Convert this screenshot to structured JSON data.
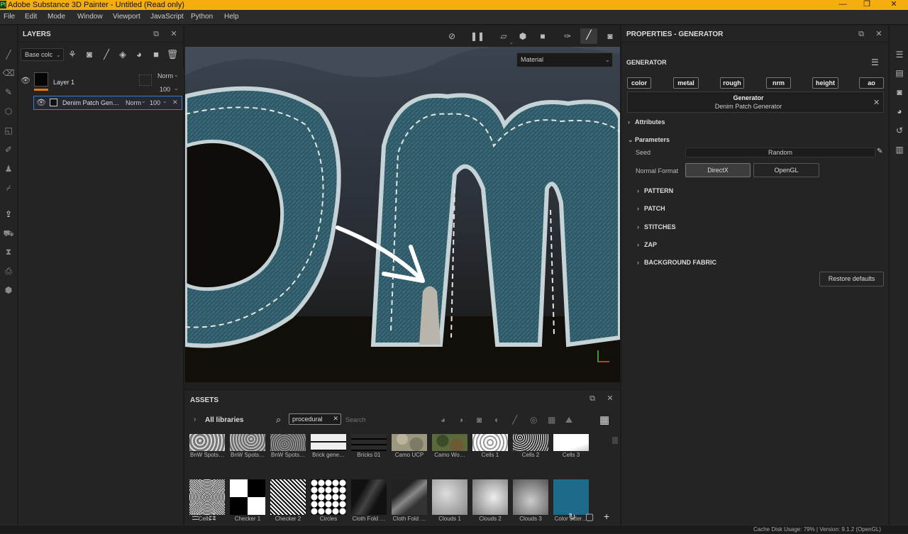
{
  "titlebar": {
    "title": "Adobe Substance 3D Painter - Untitled (Read only)",
    "minimize": "—",
    "restore": "❐",
    "close": "✕"
  },
  "menu": [
    "File",
    "Edit",
    "Mode",
    "Window",
    "Viewport",
    "JavaScript",
    "Python",
    "Help"
  ],
  "layers": {
    "title": "LAYERS",
    "channel_select": "Base colc",
    "layer1": {
      "name": "Layer 1",
      "blend": "Norm",
      "opacity": "100"
    },
    "effect": {
      "name": "Denim Patch Gen…",
      "blend": "Norm",
      "opacity": "100"
    }
  },
  "viewport": {
    "material_select": "Material"
  },
  "assets": {
    "title": "ASSETS",
    "library": "All libraries",
    "filter_tag": "procedural",
    "search_placeholder": "Search",
    "items": [
      {
        "label": "BnW Spots…",
        "pattern": "noise-light"
      },
      {
        "label": "BnW Spots…",
        "pattern": "noise-mid"
      },
      {
        "label": "BnW Spots…",
        "pattern": "noise-dark"
      },
      {
        "label": "Brick gene…",
        "pattern": "brick-white"
      },
      {
        "label": "Bricks 01",
        "pattern": "brick-dark"
      },
      {
        "label": "Camo UCP",
        "pattern": "camo-light"
      },
      {
        "label": "Camo Wo…",
        "pattern": "camo-wood"
      },
      {
        "label": "Cells 1",
        "pattern": "cells-light"
      },
      {
        "label": "Cells 2",
        "pattern": "cells-speckle"
      },
      {
        "label": "Cells 3",
        "pattern": "cells-white"
      },
      {
        "label": "Cells 4",
        "pattern": "cells-noise"
      },
      {
        "label": "Checker 1",
        "pattern": "checker"
      },
      {
        "label": "Checker 2",
        "pattern": "checker-noise"
      },
      {
        "label": "Circles",
        "pattern": "circles"
      },
      {
        "label": "Cloth Fold …",
        "pattern": "cloth-dark"
      },
      {
        "label": "Cloth Fold …",
        "pattern": "cloth-mid"
      },
      {
        "label": "Clouds 1",
        "pattern": "clouds-1"
      },
      {
        "label": "Clouds 2",
        "pattern": "clouds-2"
      },
      {
        "label": "Clouds 3",
        "pattern": "clouds-3"
      },
      {
        "label": "Color Jitter…",
        "pattern": "color-jitter"
      }
    ]
  },
  "properties": {
    "title": "PROPERTIES - GENERATOR",
    "section": "GENERATOR",
    "channels": [
      "color",
      "metal",
      "rough",
      "nrm",
      "height",
      "ao"
    ],
    "generator_label": "Generator",
    "generator_name": "Denim Patch Generator",
    "attributes": "Attributes",
    "parameters": "Parameters",
    "seed_label": "Seed",
    "seed_value": "Random",
    "normal_format_label": "Normal Format",
    "normal_options": [
      "DirectX",
      "OpenGL"
    ],
    "subsections": [
      "PATTERN",
      "PATCH",
      "STITCHES",
      "ZAP",
      "BACKGROUND FABRIC"
    ],
    "restore_defaults": "Restore defaults"
  },
  "status": {
    "text": "Cache Disk Usage:   79%  |  Version: 9.1.2 (OpenGL)"
  },
  "colors": {
    "accent": "#f6ad0f",
    "selection": "#3c7bd4",
    "denim": "#2e5866",
    "layer_mask": "#e07a1a"
  }
}
